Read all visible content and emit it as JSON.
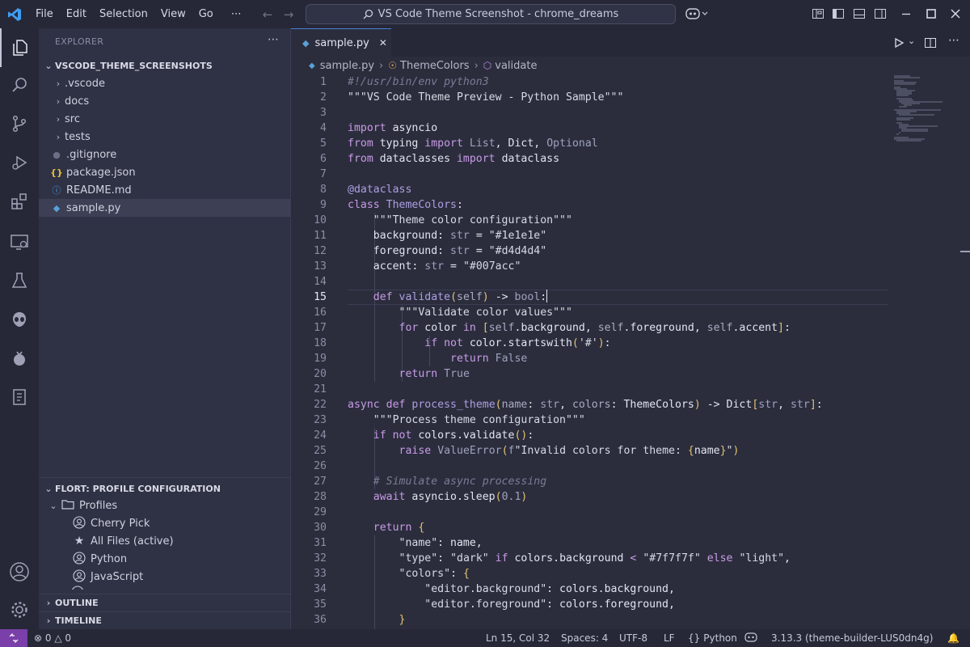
{
  "titlebar": {
    "menu": [
      "File",
      "Edit",
      "Selection",
      "View",
      "Go"
    ],
    "more": "⋯",
    "search_text": "VS Code Theme Screenshot - chrome_dreams"
  },
  "sidebar": {
    "header": "EXPLORER",
    "more": "⋯",
    "root": "VSCODE_THEME_SCREENSHOTS",
    "items": [
      {
        "label": ".vscode",
        "kind": "folder"
      },
      {
        "label": "docs",
        "kind": "folder"
      },
      {
        "label": "src",
        "kind": "folder"
      },
      {
        "label": "tests",
        "kind": "folder"
      },
      {
        "label": ".gitignore",
        "kind": "file"
      },
      {
        "label": "package.json",
        "kind": "json"
      },
      {
        "label": "README.md",
        "kind": "info"
      },
      {
        "label": "sample.py",
        "kind": "python"
      }
    ],
    "profile_section": "FLORT: PROFILE CONFIGURATION",
    "profiles_folder": "Profiles",
    "profiles": [
      "Cherry Pick",
      "All Files (active)",
      "Python",
      "JavaScript"
    ],
    "outline": "OUTLINE",
    "timeline": "TIMELINE"
  },
  "tab": {
    "label": "sample.py",
    "close": "✕"
  },
  "breadcrumb": {
    "file": "sample.py",
    "class": "ThemeColors",
    "method": "validate"
  },
  "editor": {
    "cursor_line": 15,
    "line_numbers": [
      "1",
      "2",
      "3",
      "4",
      "5",
      "6",
      "7",
      "8",
      "9",
      "10",
      "11",
      "12",
      "13",
      "14",
      "15",
      "16",
      "17",
      "18",
      "19",
      "20",
      "21",
      "22",
      "23",
      "24",
      "25",
      "26",
      "27",
      "28",
      "29",
      "30",
      "31",
      "32",
      "33",
      "34",
      "35",
      "36"
    ]
  },
  "status": {
    "errors": "0",
    "warnings": "0",
    "position": "Ln 15, Col 32",
    "spaces": "Spaces: 4",
    "encoding": "UTF-8",
    "eol": "LF",
    "language": "Python",
    "interpreter": "3.13.3 (theme-builder-LUS0dn4g)"
  },
  "colors": {
    "accent": "#7a3fa8",
    "keyword": "#c99be6",
    "comment": "#7a7d94",
    "background": "#2b2d3d"
  }
}
